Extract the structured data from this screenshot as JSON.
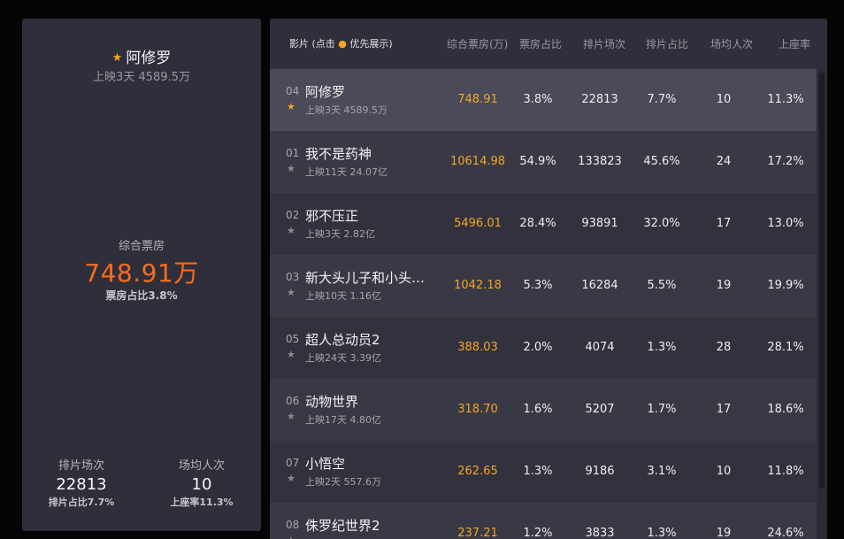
{
  "selected": {
    "title": "阿修罗",
    "subtitle": "上映3天 4589.5万",
    "box_label": "综合票房",
    "box_value": "748.91万",
    "share": "票房占比3.8%",
    "screenings_label": "排片场次",
    "screenings_value": "22813",
    "screenings_share": "排片占比7.7%",
    "avg_label": "场均人次",
    "avg_value": "10",
    "seat_rate": "上座率11.3%"
  },
  "columns": {
    "movie_prefix": "影片 (点击",
    "movie_suffix": "优先展示)",
    "box": "综合票房(万)",
    "box_share": "票房占比",
    "screenings": "排片场次",
    "screenings_share": "排片占比",
    "avg": "场均人次",
    "seat_rate": "上座率"
  },
  "rows": [
    {
      "rank": "04",
      "name": "阿修罗",
      "meta": "上映3天 4589.5万",
      "box": "748.91",
      "box_share": "3.8%",
      "screenings": "22813",
      "screenings_share": "7.7%",
      "avg": "10",
      "seat_rate": "11.3%",
      "starred": true
    },
    {
      "rank": "01",
      "name": "我不是药神",
      "meta": "上映11天 24.07亿",
      "box": "10614.98",
      "box_share": "54.9%",
      "screenings": "133823",
      "screenings_share": "45.6%",
      "avg": "24",
      "seat_rate": "17.2%",
      "starred": false
    },
    {
      "rank": "02",
      "name": "邪不压正",
      "meta": "上映3天 2.82亿",
      "box": "5496.01",
      "box_share": "28.4%",
      "screenings": "93891",
      "screenings_share": "32.0%",
      "avg": "17",
      "seat_rate": "13.0%",
      "starred": false
    },
    {
      "rank": "03",
      "name": "新大头儿子和小头…",
      "meta": "上映10天 1.16亿",
      "box": "1042.18",
      "box_share": "5.3%",
      "screenings": "16284",
      "screenings_share": "5.5%",
      "avg": "19",
      "seat_rate": "19.9%",
      "starred": false
    },
    {
      "rank": "05",
      "name": "超人总动员2",
      "meta": "上映24天 3.39亿",
      "box": "388.03",
      "box_share": "2.0%",
      "screenings": "4074",
      "screenings_share": "1.3%",
      "avg": "28",
      "seat_rate": "28.1%",
      "starred": false
    },
    {
      "rank": "06",
      "name": "动物世界",
      "meta": "上映17天 4.80亿",
      "box": "318.70",
      "box_share": "1.6%",
      "screenings": "5207",
      "screenings_share": "1.7%",
      "avg": "17",
      "seat_rate": "18.6%",
      "starred": false
    },
    {
      "rank": "07",
      "name": "小悟空",
      "meta": "上映2天 557.6万",
      "box": "262.65",
      "box_share": "1.3%",
      "screenings": "9186",
      "screenings_share": "3.1%",
      "avg": "10",
      "seat_rate": "11.8%",
      "starred": false
    },
    {
      "rank": "08",
      "name": "侏罗纪世界2",
      "meta": "",
      "box": "237.21",
      "box_share": "1.2%",
      "screenings": "3833",
      "screenings_share": "1.3%",
      "avg": "19",
      "seat_rate": "24.6%",
      "starred": false
    }
  ],
  "colors": {
    "accent_box": "#f5a623",
    "big_value": "#ff6a1c",
    "star_on": "#f5a623",
    "star_off": "#8c8c96"
  },
  "icons": {
    "star": "star-icon"
  }
}
